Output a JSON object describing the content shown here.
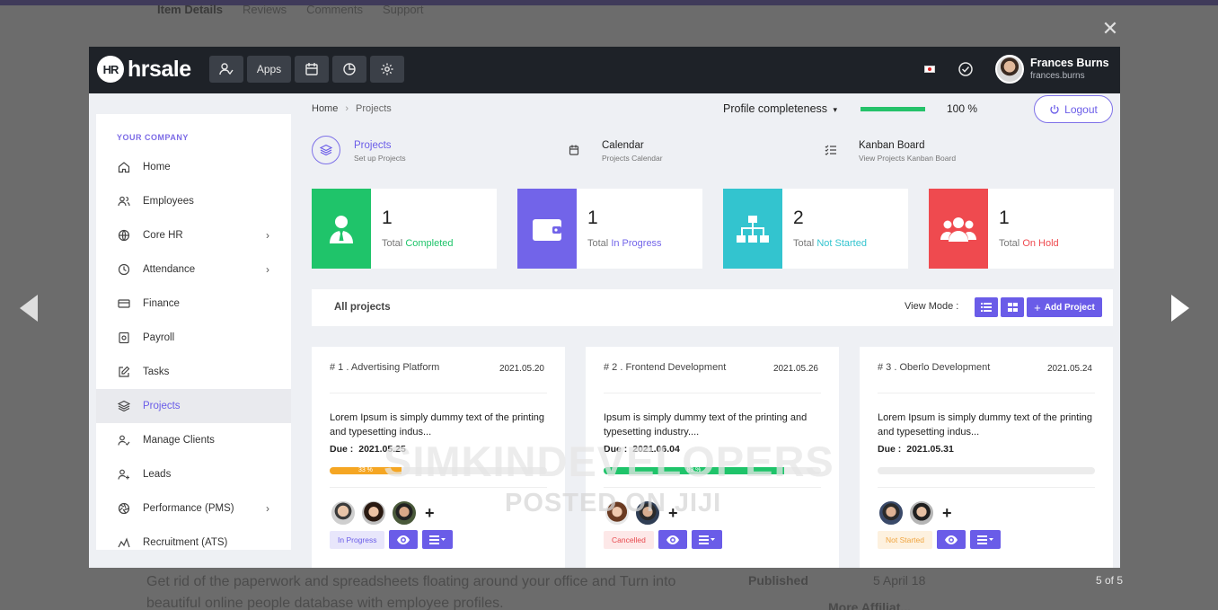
{
  "background": {
    "tabs": [
      "Item Details",
      "Reviews",
      "Comments",
      "Support"
    ],
    "text": "Get rid of the paperwork and spreadsheets floating around your office and Turn into beautiful online people database with employee profiles.",
    "published_label": "Published",
    "published_date": "5 April 18",
    "more_label": "More Affiliat..."
  },
  "lightbox": {
    "close_glyph": "✕",
    "counter": "5 of 5"
  },
  "navbar": {
    "logo_mark": "HR",
    "logo_text": "hrsale",
    "apps_label": "Apps",
    "user_name": "Frances Burns",
    "user_login": "frances.burns"
  },
  "sidebar": {
    "heading": "YOUR COMPANY",
    "items": [
      {
        "label": "Home",
        "icon": "home-icon"
      },
      {
        "label": "Employees",
        "icon": "users-icon"
      },
      {
        "label": "Core HR",
        "icon": "globe-icon",
        "chevron": "›"
      },
      {
        "label": "Attendance",
        "icon": "clock-icon",
        "chevron": "›"
      },
      {
        "label": "Finance",
        "icon": "card-icon"
      },
      {
        "label": "Payroll",
        "icon": "safe-icon"
      },
      {
        "label": "Tasks",
        "icon": "edit-icon"
      },
      {
        "label": "Projects",
        "icon": "layers-icon"
      },
      {
        "label": "Manage Clients",
        "icon": "user-check-icon"
      },
      {
        "label": "Leads",
        "icon": "user-plus-icon"
      },
      {
        "label": "Performance (PMS)",
        "icon": "aperture-icon",
        "chevron": "›"
      },
      {
        "label": "Recruitment (ATS)",
        "icon": "chart-icon"
      }
    ]
  },
  "breadcrumb": {
    "home": "Home",
    "sep": "›",
    "current": "Projects"
  },
  "profile": {
    "label": "Profile completeness",
    "caret": "▾",
    "value": "100 %",
    "fraction": 1.0
  },
  "logout_label": "Logout",
  "subnav": [
    {
      "title": "Projects",
      "subtitle": "Set up Projects"
    },
    {
      "title": "Calendar",
      "subtitle": "Projects Calendar"
    },
    {
      "title": "Kanban Board",
      "subtitle": "View Projects Kanban Board"
    }
  ],
  "stats": [
    {
      "value": "1",
      "prefix": "Total",
      "status": "Completed",
      "color": "#1fc46a"
    },
    {
      "value": "1",
      "prefix": "Total",
      "status": "In Progress",
      "color": "#7264e9"
    },
    {
      "value": "2",
      "prefix": "Total",
      "status": "Not Started",
      "color": "#33c4cf"
    },
    {
      "value": "1",
      "prefix": "Total",
      "status": "On Hold",
      "color": "#ef4a4f"
    }
  ],
  "projects_bar": {
    "title": "All projects",
    "view_mode": "View Mode :",
    "add_label": "Add Project",
    "add_plus": "+"
  },
  "projects": [
    {
      "title": "# 1 . Advertising Platform",
      "date": "2021.05.20",
      "desc": "Lorem Ipsum is simply dummy text of the printing and typesetting indus...",
      "due_label": "Due :",
      "due": "2021.05.25",
      "progress_text": "33 %",
      "progress": 0.33,
      "bar_color": "#f5a623",
      "badge": "In Progress",
      "badge_bg": "#e8e6fb",
      "badge_color": "#6a5ce8",
      "plus": "+"
    },
    {
      "title": "# 2 . Frontend Development",
      "date": "2021.05.26",
      "desc": "Ipsum is simply dummy text of the printing and typesetting industry....",
      "due_label": "Due :",
      "due": "2021.06.04",
      "progress_text": "83 %",
      "progress": 0.83,
      "bar_color": "#1fc46a",
      "badge": "Cancelled",
      "badge_bg": "#fde8e8",
      "badge_color": "#e84a4f",
      "plus": "+"
    },
    {
      "title": "# 3 . Oberlo Development",
      "date": "2021.05.24",
      "desc": "Lorem Ipsum is simply dummy text of the printing and typesetting indus...",
      "due_label": "Due :",
      "due": "2021.05.31",
      "progress_text": "",
      "progress": 0,
      "bar_color": "#cccccc",
      "badge": "Not Started",
      "badge_bg": "#fdf1df",
      "badge_color": "#f0a540",
      "plus": "+"
    }
  ],
  "watermark": {
    "line1": "SIMKINDEVELOPERS",
    "line2": "POSTED ON JIJI"
  }
}
